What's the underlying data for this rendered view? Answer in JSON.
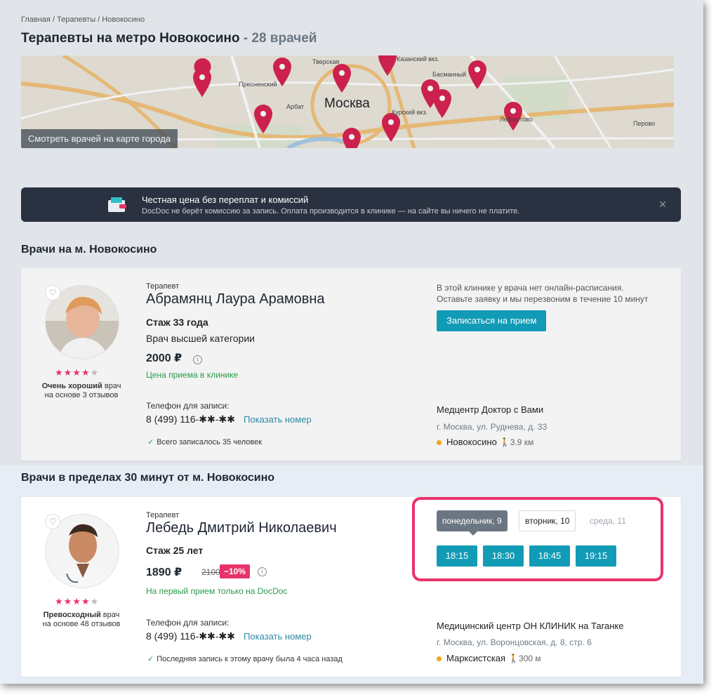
{
  "breadcrumbs": [
    "Главная",
    "Терапевты",
    "Новокосино"
  ],
  "breadcrumb_sep": " / ",
  "page_title": "Терапевты на метро Новокосино",
  "page_title_count": "- 28 врачей",
  "map": {
    "city_label": "Москва",
    "button_label": "Смотреть врачей на карте города",
    "street_labels": [
      "Пресненский",
      "Тверская",
      "Казанский вкз.",
      "Басманный",
      "Арбат",
      "Курский вкз.",
      "Перово",
      "Лефортово"
    ]
  },
  "banner": {
    "title": "Честная цена без переплат и комиссий",
    "text": "DocDoc не берёт комиссию за запись. Оплата производится в клинике — на сайте вы ничего не платите.",
    "close": "✕"
  },
  "section_metro_title": "Врачи на м. Новокосино",
  "section_near_title": "Врачи в пределах 30 минут от м. Новокосино",
  "doctors": [
    {
      "specialty": "Терапевт",
      "name": "Абрамянц Лаура Арамовна",
      "experience": "Стаж 33 года",
      "category": "Врач высшей категории",
      "price": "2000 ₽",
      "price_note": "Цена приема в клинике",
      "rating_word": "Очень хороший",
      "rating_suffix": " врач",
      "reviews": "на основе 3 отзывов",
      "stars": "★★★★",
      "stars_half": "★",
      "phone_label": "Телефон для записи:",
      "phone": "8 (499) 116-✱✱-✱✱",
      "show_number": "Показать номер",
      "booked": "Всего записалось 35 человек",
      "no_schedule": [
        "В этой клинике у врача нет онлайн-расписания.",
        "Оставьте заявку и мы перезвоним в течение 10 минут"
      ],
      "book_button": "Записаться на прием",
      "clinic_name": "Медцентр Доктор с Вами",
      "clinic_address": "г. Москва, ул. Руднева, д. 33",
      "metro": "Новокосино",
      "metro_distance": "🚶3.9 км"
    },
    {
      "specialty": "Терапевт",
      "name": "Лебедь Дмитрий Николаевич",
      "experience": "Стаж 25 лет",
      "price": "1890 ₽",
      "old_price": "2100",
      "discount": "−10%",
      "price_note": "На первый прием только на DocDoc",
      "rating_word": "Превосходный",
      "rating_suffix": " врач",
      "reviews": "на основе 48 отзывов",
      "stars": "★★★★",
      "stars_half": "★",
      "phone_label": "Телефон для записи:",
      "phone": "8 (499) 116-✱✱-✱✱",
      "show_number": "Показать номер",
      "booked": "Последняя запись к этому врачу была 4 часа назад",
      "days": [
        "понедельник, 9",
        "вторник, 10",
        "среда, 11"
      ],
      "slots": [
        "18:15",
        "18:30",
        "18:45",
        "19:15"
      ],
      "clinic_name": "Медицинский центр ОН КЛИНИК на Таганке",
      "clinic_address": "г. Москва, ул. Воронцовская, д. 8, стр. 6",
      "metro": "Марксистская",
      "metro_distance": "🚶300 м"
    }
  ],
  "colors": {
    "accent": "#119bb6",
    "pink": "#e8336a",
    "green": "#2a9a4c",
    "metro_dot": "#f2a614"
  },
  "icons": {
    "favorite": "heart-icon",
    "info": "info-icon",
    "check": "check-icon",
    "close": "close-icon",
    "walk": "walk-icon",
    "wallet": "wallet-icon",
    "map_pin": "map-pin-icon"
  }
}
